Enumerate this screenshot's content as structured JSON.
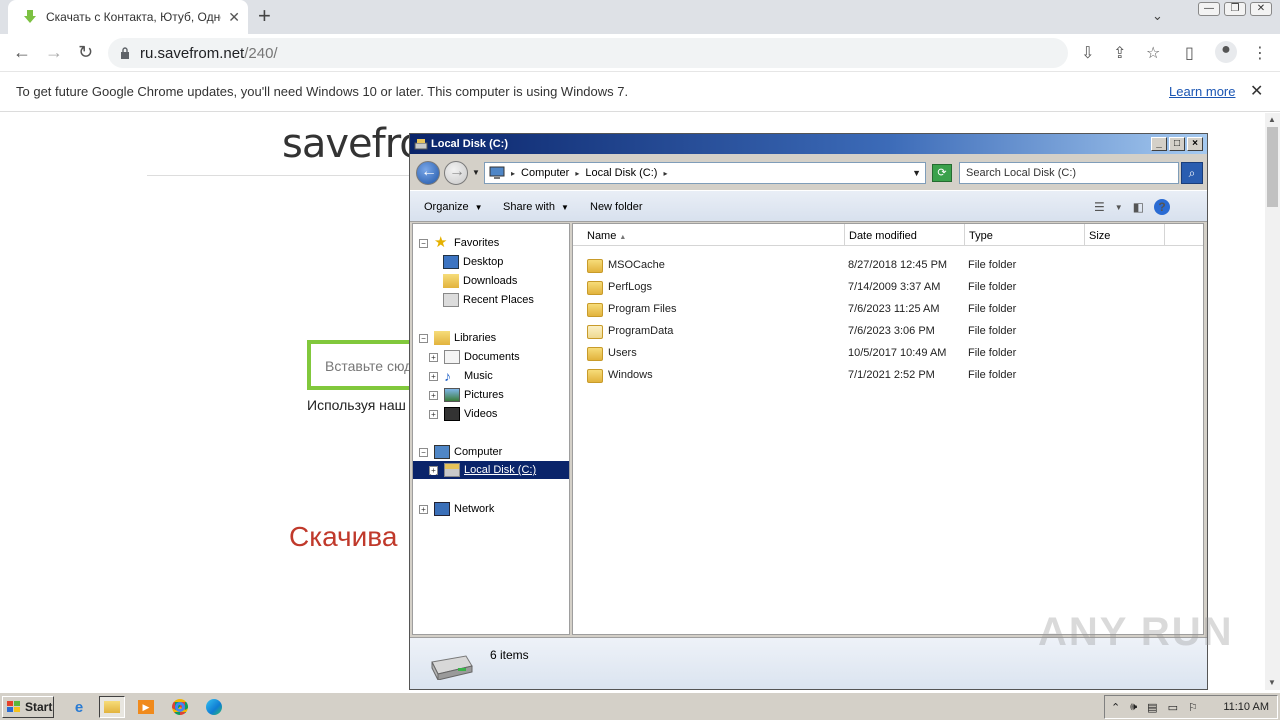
{
  "browser": {
    "tab_title": "Скачать с Контакта, Ютуб, Одноклассников",
    "address_host": "ru.savefrom.net",
    "address_path": "/240/",
    "infobar_message": "To get future Google Chrome updates, you'll need Windows 10 or later. This computer is using Windows 7.",
    "infobar_link": "Learn more"
  },
  "page": {
    "logo": "savefrom.",
    "url_placeholder": "Вставьте сюд",
    "usage_text": "Используя наш",
    "download_heading": "Скачива"
  },
  "explorer": {
    "title": "Local Disk (C:)",
    "breadcrumbs": [
      "Computer",
      "Local Disk (C:)"
    ],
    "search_placeholder": "Search Local Disk (C:)",
    "commands": {
      "organize": "Organize",
      "share_with": "Share with",
      "new_folder": "New folder"
    },
    "nav": {
      "favorites": "Favorites",
      "desktop": "Desktop",
      "downloads": "Downloads",
      "recent_places": "Recent Places",
      "libraries": "Libraries",
      "documents": "Documents",
      "music": "Music",
      "pictures": "Pictures",
      "videos": "Videos",
      "computer": "Computer",
      "local_disk": "Local Disk (C:)",
      "network": "Network"
    },
    "columns": {
      "name": "Name",
      "date_modified": "Date modified",
      "type": "Type",
      "size": "Size"
    },
    "files": [
      {
        "name": "MSOCache",
        "date": "8/27/2018 12:45 PM",
        "type": "File folder"
      },
      {
        "name": "PerfLogs",
        "date": "7/14/2009 3:37 AM",
        "type": "File folder"
      },
      {
        "name": "Program Files",
        "date": "7/6/2023 11:25 AM",
        "type": "File folder"
      },
      {
        "name": "ProgramData",
        "date": "7/6/2023 3:06 PM",
        "type": "File folder"
      },
      {
        "name": "Users",
        "date": "10/5/2017 10:49 AM",
        "type": "File folder"
      },
      {
        "name": "Windows",
        "date": "7/1/2021 2:52 PM",
        "type": "File folder"
      }
    ],
    "status_count": "6 items"
  },
  "taskbar": {
    "start_label": "Start",
    "clock": "11:10 AM"
  },
  "watermark": "ANY RUN"
}
